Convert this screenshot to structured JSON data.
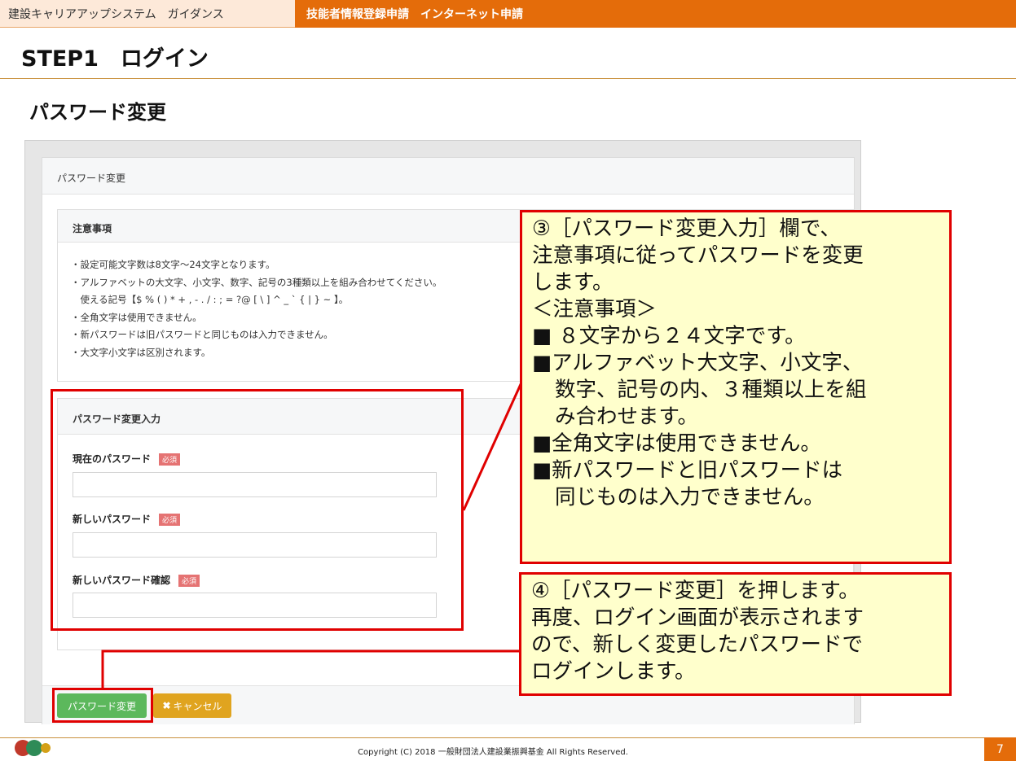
{
  "header": {
    "left_title": "建設キャリアアップシステム　ガイダンス",
    "right_title": "技能者情報登録申請　インターネット申請"
  },
  "step_title": "STEP1　ログイン",
  "page_heading": "パスワード変更",
  "panel": {
    "title": "パスワード変更",
    "notes": {
      "title": "注意事項",
      "items": [
        "・設定可能文字数は8文字～24文字となります。",
        "・アルファベットの大文字、小文字、数字、記号の3種類以上を組み合わせてください。",
        "　使える記号【$ % ( ) * + , - . / : ; = ?@ [ \\ ] ^ _ ` { | } ~ 】。",
        "・全角文字は使用できません。",
        "・新パスワードは旧パスワードと同じものは入力できません。",
        "・大文字小文字は区別されます。"
      ]
    },
    "input": {
      "title": "パスワード変更入力",
      "required_label": "必須",
      "fields": [
        {
          "label": "現在のパスワード",
          "value": ""
        },
        {
          "label": "新しいパスワード",
          "value": ""
        },
        {
          "label": "新しいパスワード確認",
          "value": ""
        }
      ]
    },
    "buttons": {
      "change": "パスワード変更",
      "cancel": "キャンセル"
    }
  },
  "callout3": {
    "lines": [
      "③［パスワード変更入力］欄で、",
      "注意事項に従ってパスワードを変更",
      "します。",
      "＜注意事項＞",
      "■ ８文字から２４文字です。",
      "■アルファベット大文字、小文字、",
      "数字、記号の内、３種類以上を組",
      "み合わせます。",
      "■全角文字は使用できません。",
      "■新パスワードと旧パスワードは",
      "同じものは入力できません。"
    ]
  },
  "callout4": {
    "lines": [
      "④［パスワード変更］を押します。",
      "再度、ログイン画面が表示されます",
      "ので、新しく変更したパスワードで",
      "ログインします。"
    ]
  },
  "footer": {
    "copyright": "Copyright (C) 2018 一般財団法人建設業振興基金 All Rights Reserved.",
    "page_number": "7"
  },
  "colors": {
    "accent_orange": "#e46c0a",
    "highlight_red": "#e00000",
    "callout_bg": "#ffffcc",
    "button_green": "#5cb85c",
    "button_amber": "#e0a41f"
  }
}
